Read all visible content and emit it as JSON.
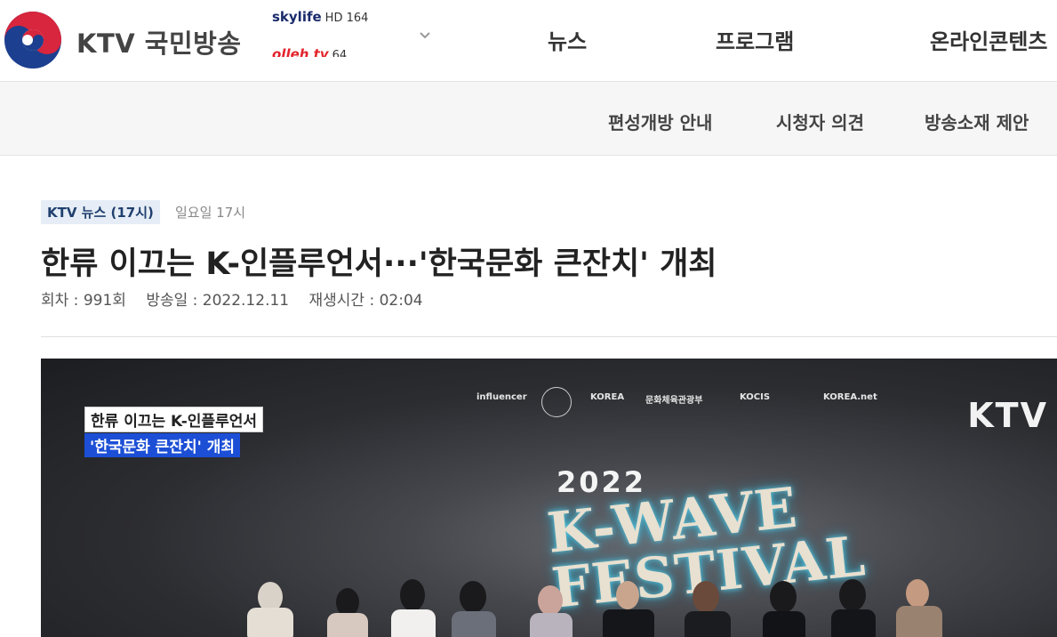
{
  "header": {
    "logo_text": "KTV 국민방송",
    "channels": [
      {
        "brand": "skylife",
        "number": "HD 164"
      },
      {
        "brand": "olleh tv",
        "number": "64"
      }
    ],
    "nav": [
      "뉴스",
      "프로그램",
      "온라인콘텐츠"
    ]
  },
  "subnav": [
    "편성개방 안내",
    "시청자 의견",
    "방송소재 제안"
  ],
  "article": {
    "badge": "KTV 뉴스 (17시)",
    "day": "일요일 17시",
    "title": "한류 이끄는 K-인플루언서···'한국문화 큰잔치' 개최",
    "meta": {
      "episode": "회차 : 991회",
      "air_date": "방송일 : 2022.12.11",
      "duration": "재생시간 : 02:04"
    }
  },
  "video": {
    "caption_line1": "한류 이끄는 K-인플루언서",
    "caption_line2": "'한국문화 큰잔치' 개최",
    "watermark": "KTV",
    "sponsors": [
      "influencer",
      "KOREA",
      "문화체육관광부",
      "KOCIS",
      "KOREA.net"
    ],
    "festival_year": "2022",
    "festival_line1": "K-WAVE",
    "festival_line2": "FESTIVAL"
  },
  "colors": {
    "badge_bg": "#e6edf6",
    "badge_text": "#20406e",
    "caption_blue": "#1c4fd6",
    "logo_red": "#d7263d",
    "logo_navy": "#1c3f8f"
  }
}
